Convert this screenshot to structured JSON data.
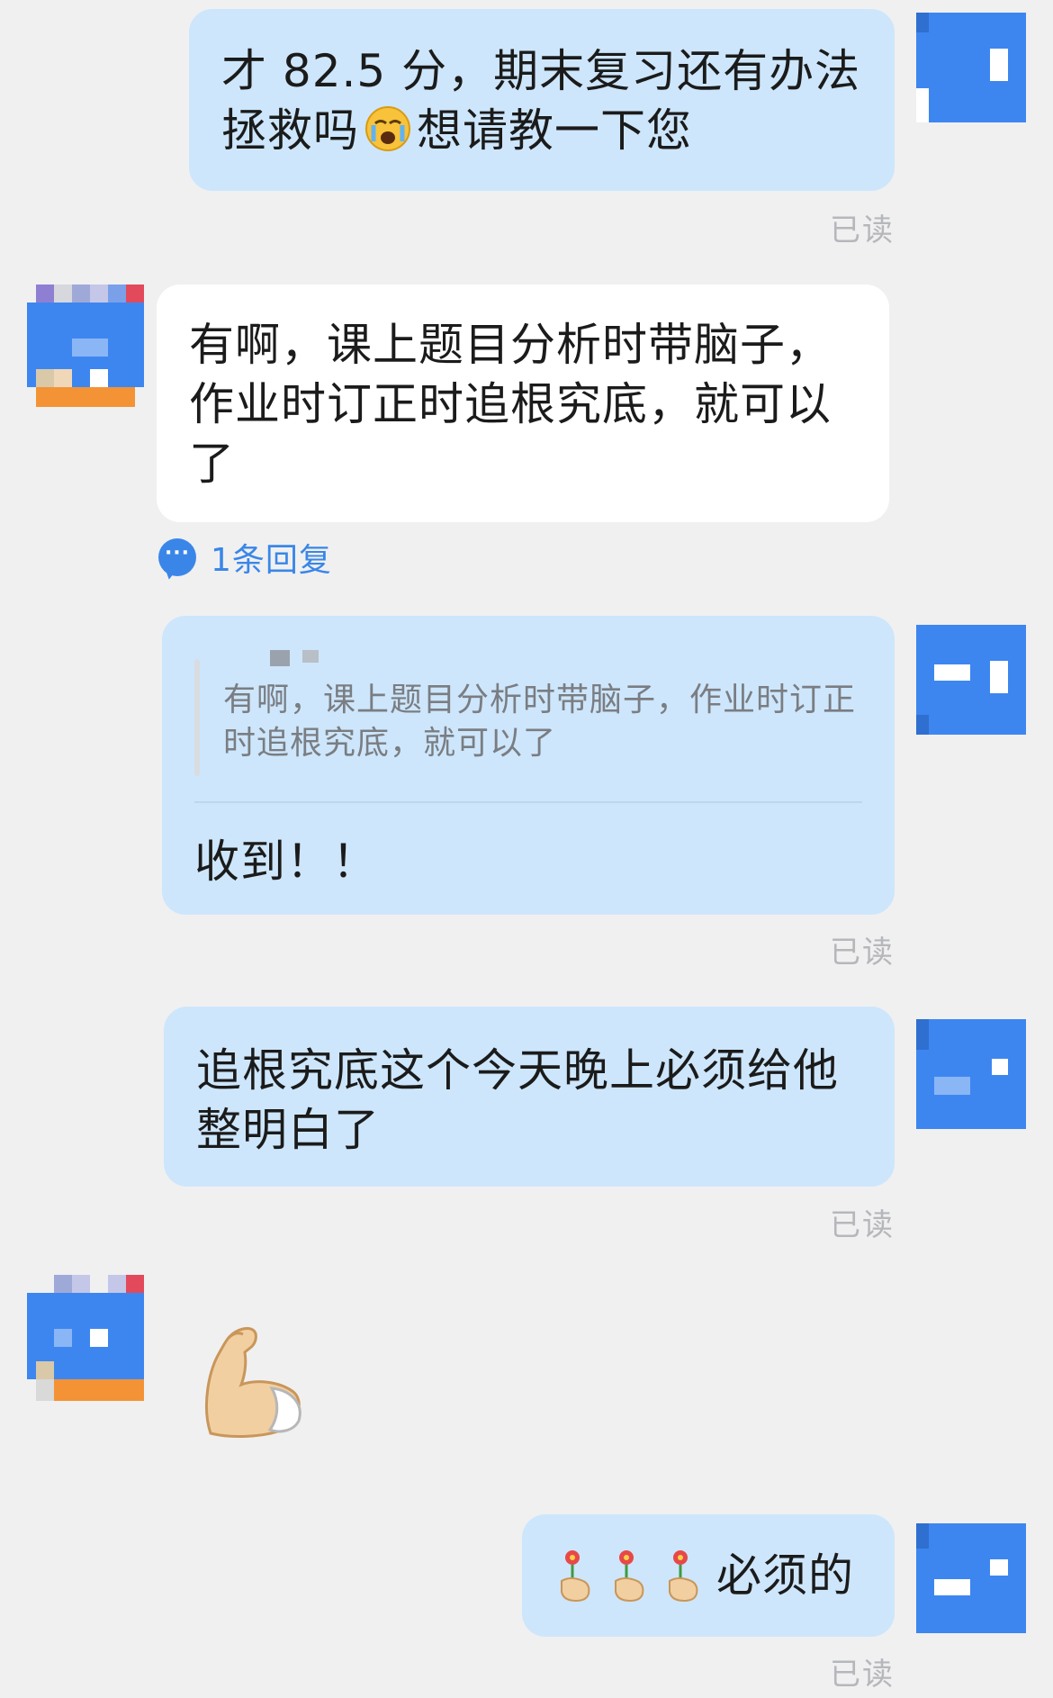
{
  "messages": [
    {
      "text": "才 82.5 分，期末复习还有办法\n拯救吗",
      "text_after_emoji": "想请教一下您",
      "read": "已读"
    },
    {
      "text": "有啊，课上题目分析时带脑子，\n作业时订正时追根究底，就可以\n了"
    },
    {
      "quote": "有啊，课上题目分析时带脑子，作业时订正\n时追根究底，就可以了",
      "text": "收到！！",
      "read": "已读"
    },
    {
      "text": "追根究底这个今天晚上必须给他\n整明白了",
      "read": "已读"
    },
    {
      "emoji_name": "flexed-biceps-sticker"
    },
    {
      "text": "必须的",
      "read": "已读"
    }
  ],
  "reply_link": {
    "label": "1条回复",
    "icon": "speech-bubble-icon"
  },
  "colors": {
    "mine_bubble": "#cde6fb",
    "theirs_bubble": "#ffffff",
    "background": "#f0f0f1",
    "link": "#3a86e8",
    "read": "#b6b7bb"
  }
}
